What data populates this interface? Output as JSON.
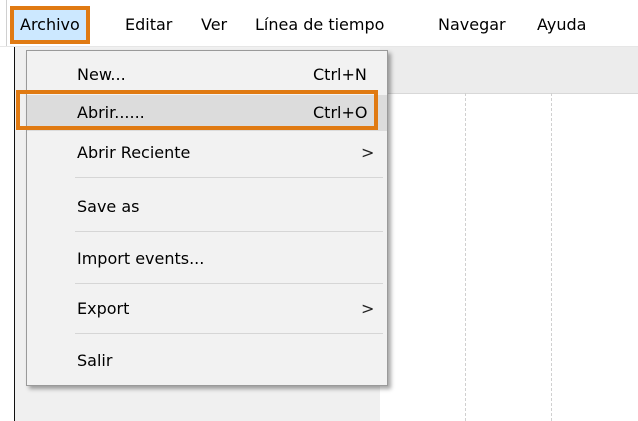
{
  "menubar": {
    "items": [
      {
        "label": "Archivo"
      },
      {
        "label": "Editar"
      },
      {
        "label": "Ver"
      },
      {
        "label": "Línea de tiempo"
      },
      {
        "label": "Navegar"
      },
      {
        "label": "Ayuda"
      }
    ]
  },
  "file_menu": {
    "items": [
      {
        "label": "New...",
        "shortcut": "Ctrl+N"
      },
      {
        "label": "Abrir......",
        "shortcut": "Ctrl+O"
      },
      {
        "label": "Abrir Reciente",
        "submenu_icon": "chevron-right-icon",
        "arrow": ">"
      },
      {
        "label": "Save as"
      },
      {
        "label": "Import events..."
      },
      {
        "label": "Export",
        "submenu_icon": "chevron-right-icon",
        "arrow": ">"
      },
      {
        "label": "Salir"
      }
    ]
  },
  "colors": {
    "highlight_outline": "#e07a12",
    "menu_background": "#f2f2f2",
    "selected_item": "#dcdcdc"
  }
}
